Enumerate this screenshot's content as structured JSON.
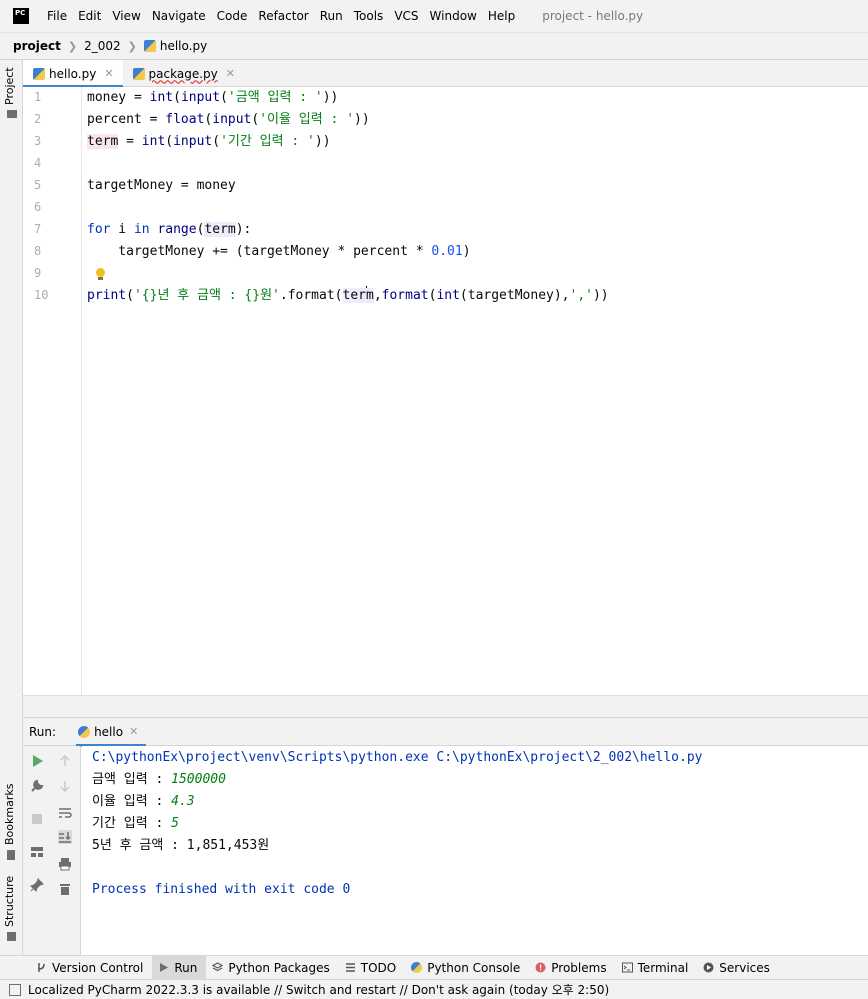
{
  "app": {
    "logo_text": "PC",
    "window_title": "project - hello.py"
  },
  "menu": [
    "File",
    "Edit",
    "View",
    "Navigate",
    "Code",
    "Refactor",
    "Run",
    "Tools",
    "VCS",
    "Window",
    "Help"
  ],
  "breadcrumb": {
    "project": "project",
    "folder": "2_002",
    "file": "hello.py"
  },
  "left_strip": {
    "project": "Project",
    "bookmarks": "Bookmarks",
    "structure": "Structure"
  },
  "tabs": [
    {
      "label": "hello.py",
      "active": true
    },
    {
      "label": "package.py",
      "active": false
    }
  ],
  "line_numbers": [
    "1",
    "2",
    "3",
    "4",
    "5",
    "6",
    "7",
    "8",
    "9",
    "10"
  ],
  "code": {
    "l1": {
      "a": "money = ",
      "b": "int",
      "c": "(",
      "d": "input",
      "e": "(",
      "f": "'금액 입력 : '",
      "g": "))"
    },
    "l2": {
      "a": "percent = ",
      "b": "float",
      "c": "(",
      "d": "input",
      "e": "(",
      "f": "'이율 입력 : '",
      "g": "))"
    },
    "l3": {
      "a": "term",
      "b": " = ",
      "c": "int",
      "d": "(",
      "e": "input",
      "f": "(",
      "g": "'기간 입력 : '",
      "h": "))"
    },
    "l5": "targetMoney = money",
    "l7": {
      "a": "for",
      "b": " i ",
      "c": "in",
      "d": " ",
      "e": "range",
      "f": "(",
      "g": "term",
      "h": "):"
    },
    "l8": {
      "a": "    targetMoney += (targetMoney * percent * ",
      "b": "0.01",
      "c": ")"
    },
    "l10": {
      "a": "print",
      "b": "(",
      "c": "'{}년 후 금액 : {}원'",
      "d": ".format(",
      "e": "ter",
      "f": "m",
      "g": ",",
      "h": "format",
      "i": "(",
      "j": "int",
      "k": "(targetMoney),",
      "l": "','",
      "m": "))"
    }
  },
  "run": {
    "label": "Run:",
    "tab": "hello",
    "lines": {
      "cmd": "C:\\pythonEx\\project\\venv\\Scripts\\python.exe C:\\pythonEx\\project\\2_002\\hello.py",
      "p1": "금액 입력 : ",
      "v1": "1500000",
      "p2": "이율 입력 : ",
      "v2": "4.3",
      "p3": "기간 입력 : ",
      "v3": "5",
      "result": "5년 후 금액 : 1,851,453원",
      "exit": "Process finished with exit code 0"
    }
  },
  "bottom_tools": [
    "Version Control",
    "Run",
    "Python Packages",
    "TODO",
    "Python Console",
    "Problems",
    "Terminal",
    "Services"
  ],
  "status": "Localized PyCharm 2022.3.3 is available // Switch and restart // Don't ask again (today 오후 2:50)",
  "colors": {
    "accent": "#4083c9",
    "keyword": "#0033b3",
    "string": "#067d17",
    "number": "#1750eb",
    "run_green": "#59a869"
  }
}
